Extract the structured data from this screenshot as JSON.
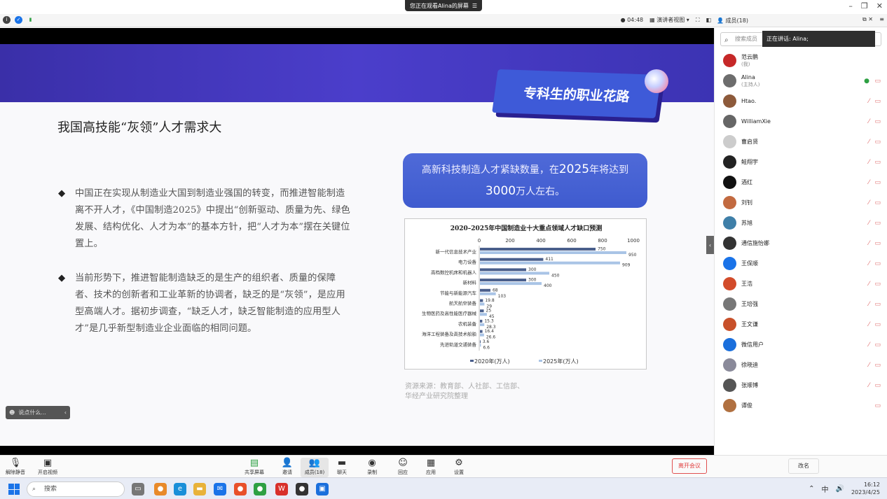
{
  "banner": {
    "text": "您正在观看Alina的屏幕",
    "menu_icon": "menu-icon"
  },
  "window_controls": {
    "minimize": "–",
    "restore": "❐",
    "close": "✕"
  },
  "toolbar": {
    "timer": "04:48",
    "view_label": "演讲者视图",
    "members_label": "成员(18)"
  },
  "slide": {
    "badge": "专科生的职业花路",
    "title": "我国高技能“灰领”人才需求大",
    "bullets": [
      "中国正在实现从制造业大国到制造业强国的转变，而推进智能制造离不开人才，《中国制造2025》中提出“创新驱动、质量为先、绿色发展、结构优化、人才为本”的基本方针，把“人才为本”摆在关键位置上。",
      "当前形势下，推进智能制造缺乏的是生产的组织者、质量的保障者、技术的创新者和工业革新的协调者，缺乏的是“灰领”，是应用型高端人才。据初步调查，“缺乏人才，缺乏智能制造的应用型人才”是几乎新型制造业企业面临的相同问题。"
    ],
    "callout_pre": "高新科技制造人才紧缺数量，在",
    "callout_year": "2025",
    "callout_mid": "年将达到",
    "callout_num": "3000",
    "callout_post": "万人左右。",
    "source_line1": "资源来源：教育部、人社部、工信部、",
    "source_line2": "华经产业研究院整理"
  },
  "chart_data": {
    "type": "bar",
    "orientation": "horizontal",
    "title": "2020–2025年中国制造业十大重点领域人才缺口预测",
    "categories": [
      "新一代信息技术产业",
      "电力设备",
      "高档数控机床和机器人",
      "新材料",
      "节能与新能源汽车",
      "航天航空装备",
      "生物医药及高性能医疗器械",
      "农机装备",
      "海洋工程装备及高技术船舶",
      "先进轨道交通装备"
    ],
    "series": [
      {
        "name": "2020年(万人)",
        "values": [
          750,
          411,
          300,
          300,
          68,
          19.8,
          25,
          15.3,
          16.4,
          3.6
        ],
        "color": "#4a5f8c"
      },
      {
        "name": "2025年(万人)",
        "values": [
          950,
          909,
          450,
          400,
          103,
          29,
          45,
          28.3,
          26.6,
          6.6
        ],
        "color": "#a9c4e6"
      }
    ],
    "xlim": [
      0,
      1000
    ],
    "xticks": [
      "0",
      "200",
      "400",
      "600",
      "800",
      "1000"
    ],
    "grid": false,
    "legend": "bottom"
  },
  "ui": {
    "speaker_widget": "说点什么...",
    "collapse_icon": "chevron-left-icon"
  },
  "members": {
    "search_placeholder": "搜索成员",
    "speaking": "正在讲话: Alina;",
    "list": [
      {
        "name": "范云鹏",
        "sub": "(我)",
        "color": "#c62828"
      },
      {
        "name": "Alina",
        "sub": "(主持人)",
        "color": "#6d6d6d"
      },
      {
        "name": "Htao.",
        "sub": "",
        "color": "#8d5a3b"
      },
      {
        "name": "WilliamXie",
        "sub": "",
        "color": "#666"
      },
      {
        "name": "曹启贤",
        "sub": "",
        "color": "#ccc"
      },
      {
        "name": "鲑翔宇",
        "sub": "",
        "color": "#222"
      },
      {
        "name": "酒红",
        "sub": "",
        "color": "#111"
      },
      {
        "name": "刘钊",
        "sub": "",
        "color": "#c26a40"
      },
      {
        "name": "苏旭",
        "sub": "",
        "color": "#3f7fa8"
      },
      {
        "name": "通信施怡娜",
        "sub": "",
        "color": "#333"
      },
      {
        "name": "王保顺",
        "sub": "",
        "color": "#1a73e8"
      },
      {
        "name": "王浩",
        "sub": "",
        "color": "#d24b2a"
      },
      {
        "name": "王培强",
        "sub": "",
        "color": "#777"
      },
      {
        "name": "王文谦",
        "sub": "",
        "color": "#c8502a"
      },
      {
        "name": "微信用户",
        "sub": "",
        "color": "#1a6fdc"
      },
      {
        "name": "徐晓迪",
        "sub": "",
        "color": "#8a8a9a"
      },
      {
        "name": "张顺博",
        "sub": "",
        "color": "#555"
      },
      {
        "name": "谭俊",
        "sub": "",
        "color": "#b07040"
      }
    ],
    "rename_button": "改名"
  },
  "controls": {
    "unmute": "解除静音",
    "video": "开启视频",
    "share": "共享屏幕",
    "invite": "邀请",
    "members": "成员(18)",
    "chat": "聊天",
    "record": "录制",
    "reactions": "回应",
    "apps": "应用",
    "settings": "设置",
    "leave": "离开会议"
  },
  "taskbar": {
    "search": "搜索",
    "ime": "中",
    "time": "16:12",
    "date": "2023/4/25"
  }
}
